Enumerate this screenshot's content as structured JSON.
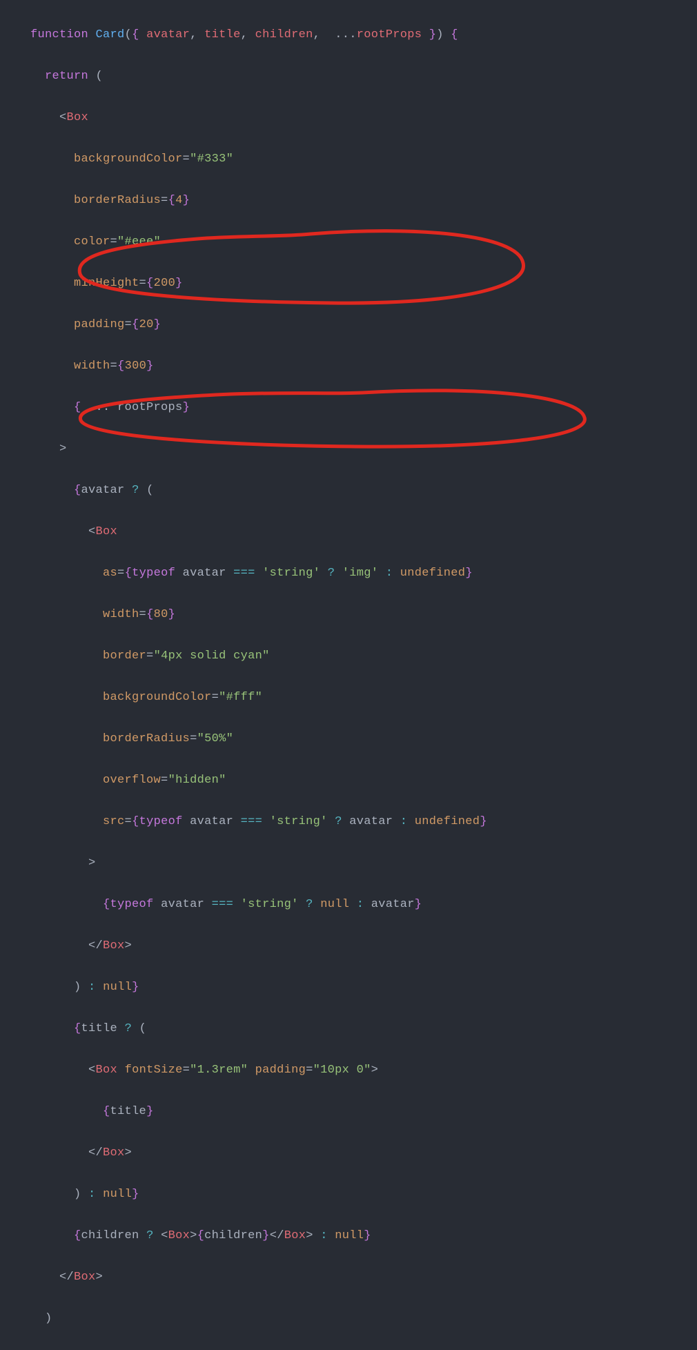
{
  "tokens": {
    "function": "function",
    "Card": "Card",
    "avatar": "avatar",
    "title": "title",
    "children": "children",
    "rootProps": "rootProps",
    "return": "return",
    "Box": "Box",
    "backgroundColor": "backgroundColor",
    "borderRadius": "borderRadius",
    "color": "color",
    "minHeight": "minHeight",
    "padding": "padding",
    "width": "width",
    "as": "as",
    "border": "border",
    "overflow": "overflow",
    "src": "src",
    "fontSize": "fontSize",
    "typeof": "typeof",
    "undefined": "undefined",
    "null": "null"
  },
  "strings": {
    "c333": "\"#333\"",
    "ceee": "\"#eee\"",
    "cfff": "\"#fff\"",
    "fiftyPct": "\"50%\"",
    "hidden": "\"hidden\"",
    "borderVal": "\"4px solid cyan\"",
    "img": "'img'",
    "string": "'string'",
    "fontSizeVal": "\"1.3rem\"",
    "paddingVal": "\"10px 0\""
  },
  "numbers": {
    "four": "4",
    "twoHundred": "200",
    "twenty": "20",
    "threeHundred": "300",
    "eighty": "80"
  }
}
